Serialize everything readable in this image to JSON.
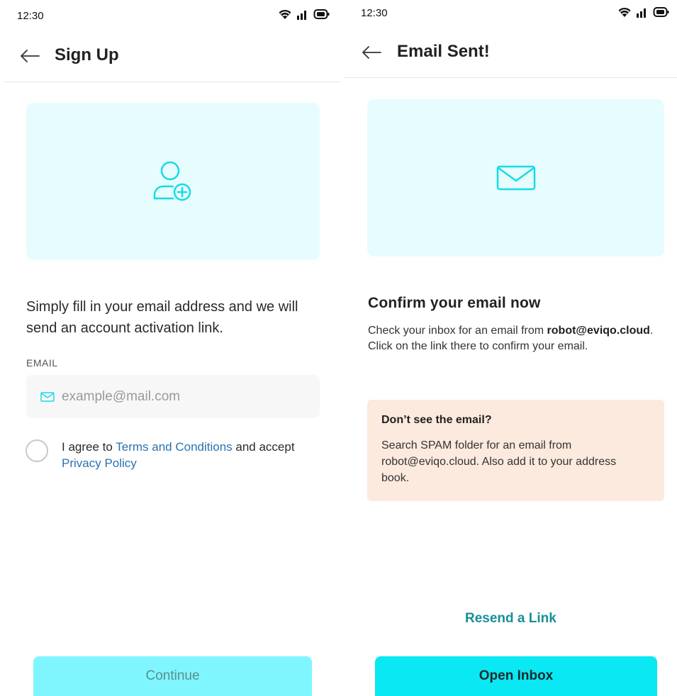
{
  "signup": {
    "status_time": "12:30",
    "title": "Sign Up",
    "intro": "Simply fill in your email address and we will send an account activation link.",
    "email_label": "EMAIL",
    "email_placeholder": "example@mail.com",
    "email_value": "",
    "agree_prefix": "I agree to ",
    "terms_link": "Terms and Conditions",
    "agree_middle": " and accept ",
    "privacy_link": "Privacy Policy",
    "agree_checked": false,
    "continue_label": "Continue"
  },
  "email_sent": {
    "status_time": "12:30",
    "title": "Email Sent!",
    "heading": "Confirm your email now",
    "message_prefix": "Check your inbox for an email from ",
    "message_email": "robot@eviqo.cloud",
    "message_suffix": ". Click on the link there to confirm your email.",
    "notice_title": "Don’t see the email?",
    "notice_text": "Search SPAM folder for an email from robot@eviqo.cloud. Also add it to your address book.",
    "resend_label": "Resend a Link",
    "open_inbox_label": "Open Inbox"
  },
  "icons": {
    "status": [
      "wifi-icon",
      "signal-icon",
      "battery-icon"
    ],
    "back": "arrow-left-icon",
    "signup_hero": "user-add-icon",
    "sent_hero": "envelope-icon",
    "email_field": "mail-icon"
  },
  "colors": {
    "accent": "#0ae8f3",
    "accent_disabled": "#7ff6fd",
    "hero_bg": "#e7fcfe",
    "icon_stroke": "#16dbe8",
    "link": "#2b72b0",
    "resend": "#178f96",
    "notice_bg": "#fbeadd"
  }
}
